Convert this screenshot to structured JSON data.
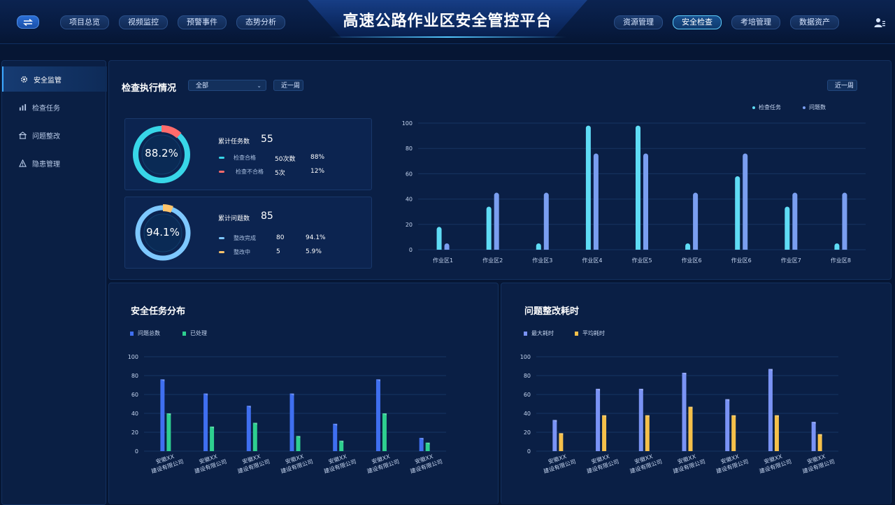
{
  "header": {
    "title": "高速公路作业区安全管控平台",
    "nav_left": [
      "项目总览",
      "视频监控",
      "预警事件",
      "态势分析"
    ],
    "nav_right": [
      "资源管理",
      "安全检查",
      "考培管理",
      "数据资产"
    ],
    "active_nav": "安全检查"
  },
  "sidebar": {
    "items": [
      {
        "label": "安全监管",
        "icon": "gear-icon",
        "active": true
      },
      {
        "label": "检查任务",
        "icon": "bar-chart-icon",
        "active": false
      },
      {
        "label": "问题整改",
        "icon": "building-icon",
        "active": false
      },
      {
        "label": "隐患管理",
        "icon": "warning-icon",
        "active": false
      }
    ]
  },
  "inspection": {
    "title": "检查执行情况",
    "filter_value": "全部",
    "period": "近一周",
    "chart_period": "近一周",
    "task_card": {
      "percent_text": "88.2%",
      "percent": 88.2,
      "total_label": "累计任务数",
      "total": "55",
      "rows": [
        {
          "label": "检查合格",
          "count": "50次数",
          "pct": "88%",
          "color": "#38d6e8"
        },
        {
          "label": "检查不合格",
          "count": "5次",
          "pct": "12%",
          "color": "#ff6b6b"
        }
      ]
    },
    "issue_card": {
      "percent_text": "94.1%",
      "percent": 94.1,
      "total_label": "累计问题数",
      "total": "85",
      "rows": [
        {
          "label": "整改完成",
          "count": "80",
          "pct": "94.1%",
          "color": "#7ec8ff"
        },
        {
          "label": "整改中",
          "count": "5",
          "pct": "5.9%",
          "color": "#ffc46b"
        }
      ]
    }
  },
  "task_dist_title": "安全任务分布",
  "rectify_title": "问题整改耗时",
  "colors": {
    "teal": "#38d6e8",
    "red": "#ff6b6b",
    "light_blue": "#7ec8ff",
    "orange": "#ffc46b",
    "blue": "#3f6ff0",
    "green": "#2ecf8f",
    "periwinkle": "#7a93f5",
    "gold": "#f5c04a"
  },
  "chart_data": [
    {
      "type": "bar",
      "categories": [
        "作业区1",
        "作业区2",
        "作业区3",
        "作业区4",
        "作业区5",
        "作业区6",
        "作业区6",
        "作业区7",
        "作业区8"
      ],
      "series": [
        {
          "name": "检查任务",
          "values": [
            18,
            34,
            5,
            98,
            98,
            5,
            58,
            34,
            5
          ],
          "color": "#5fdcf5"
        },
        {
          "name": "问题数",
          "values": [
            5,
            45,
            45,
            76,
            76,
            45,
            76,
            45,
            45
          ],
          "color": "#7a9ef0"
        }
      ],
      "ylim": [
        0,
        100
      ],
      "yticks": [
        0,
        20,
        40,
        60,
        80,
        100
      ],
      "legend": "top-right",
      "grid": true
    },
    {
      "type": "bar",
      "categories": [
        "安徽XX\n建设有限公司",
        "安徽XX\n建设有限公司",
        "安徽XX\n建设有限公司",
        "安徽XX\n建设有限公司",
        "安徽XX\n建设有限公司",
        "安徽XX\n建设有限公司",
        "安徽XX\n建设有限公司"
      ],
      "series": [
        {
          "name": "问题总数",
          "values": [
            76,
            61,
            48,
            61,
            29,
            76,
            14
          ],
          "color": "#3f6ff0"
        },
        {
          "name": "已处理",
          "values": [
            40,
            26,
            30,
            16,
            11,
            40,
            9
          ],
          "color": "#2ecf8f"
        }
      ],
      "ylim": [
        0,
        100
      ],
      "yticks": [
        0,
        20,
        40,
        60,
        80,
        100
      ],
      "legend": "top-left",
      "grid": true
    },
    {
      "type": "bar",
      "categories": [
        "安徽XX\n建设有限公司",
        "安徽XX\n建设有限公司",
        "安徽XX\n建设有限公司",
        "安徽XX\n建设有限公司",
        "安徽XX\n建设有限公司",
        "安徽XX\n建设有限公司",
        "安徽XX\n建设有限公司"
      ],
      "series": [
        {
          "name": "最大耗时",
          "values": [
            33,
            66,
            66,
            83,
            55,
            87,
            31
          ],
          "color": "#7a93f5"
        },
        {
          "name": "平均耗时",
          "values": [
            19,
            38,
            38,
            47,
            38,
            38,
            18
          ],
          "color": "#f5c04a"
        }
      ],
      "ylim": [
        0,
        100
      ],
      "yticks": [
        0,
        20,
        40,
        60,
        80,
        100
      ],
      "legend": "top-left",
      "grid": true
    }
  ]
}
